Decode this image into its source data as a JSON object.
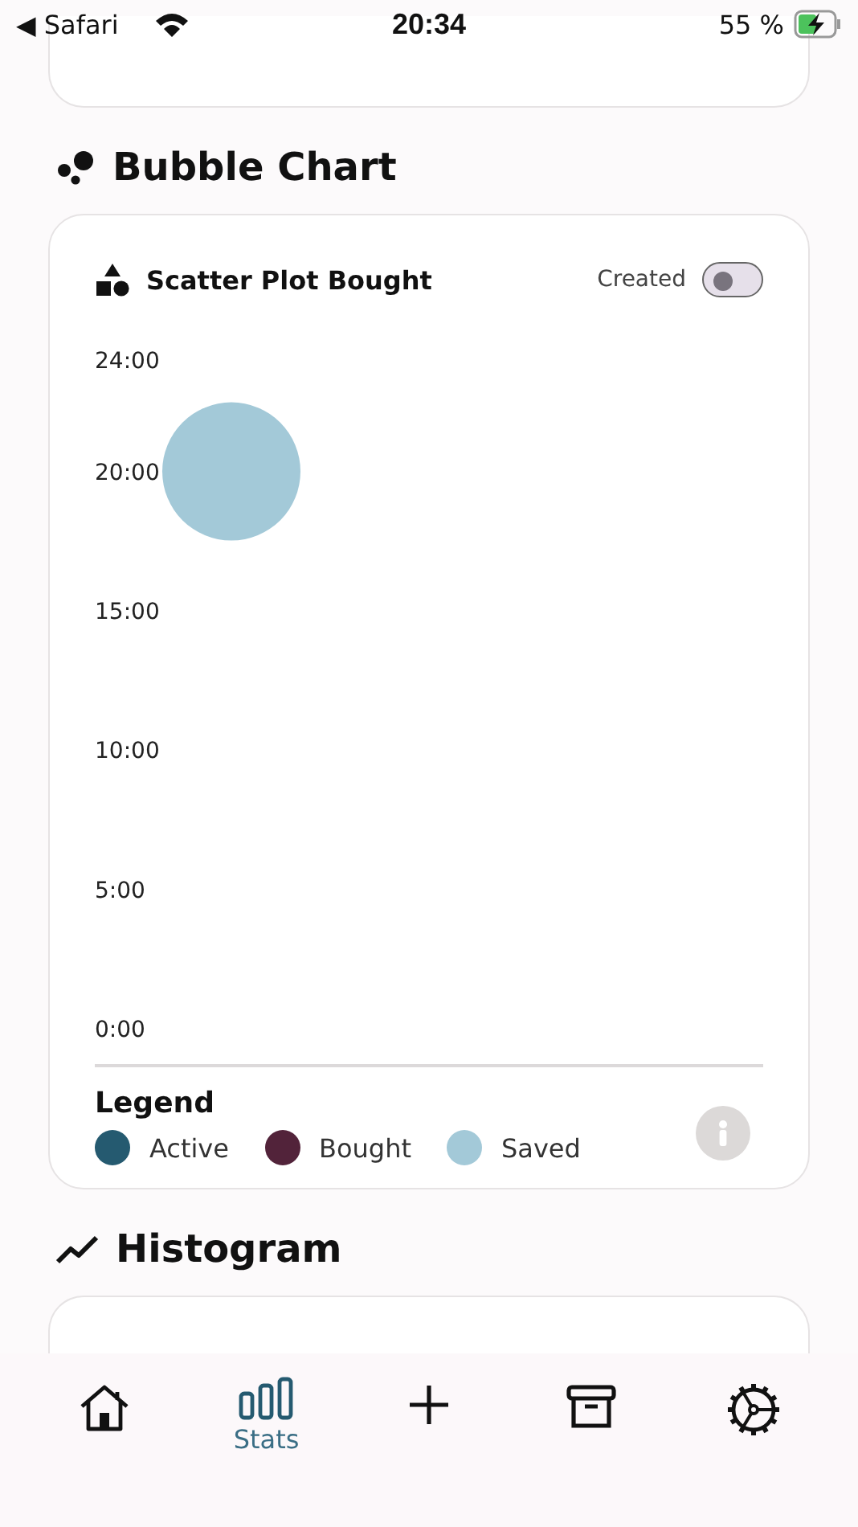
{
  "status_bar": {
    "back": "◀ Safari",
    "time": "20:34",
    "battery": "55 %"
  },
  "sections": [
    {
      "title": "Bubble Chart",
      "card": {
        "title": "Scatter Plot Bought",
        "toggle": {
          "label": "Created",
          "on": false
        },
        "chart_data": {
          "type": "scatter",
          "ylim": [
            0,
            24
          ],
          "yticks": [
            {
              "value": 0,
              "label": "0:00"
            },
            {
              "value": 5,
              "label": "5:00"
            },
            {
              "value": 10,
              "label": "10:00"
            },
            {
              "value": 15,
              "label": "15:00"
            },
            {
              "value": 20,
              "label": "20:00"
            },
            {
              "value": 24,
              "label": "24:00"
            }
          ],
          "categories": [
            null
          ],
          "series": [
            {
              "color": "#a3c9d8",
              "values": [
                20
              ]
            }
          ]
        },
        "legend": {
          "title": "Legend",
          "items": [
            {
              "label": "Active",
              "color": "#255a70"
            },
            {
              "label": "Bought",
              "color": "#52233a"
            },
            {
              "label": "Saved",
              "color": "#a3c9d8"
            }
          ]
        }
      }
    },
    {
      "title": "Histogram"
    }
  ],
  "tabs": [
    {
      "selected": false
    },
    {
      "label": "Stats",
      "selected": true
    },
    {
      "selected": false
    },
    {
      "selected": false
    },
    {
      "selected": false
    }
  ]
}
